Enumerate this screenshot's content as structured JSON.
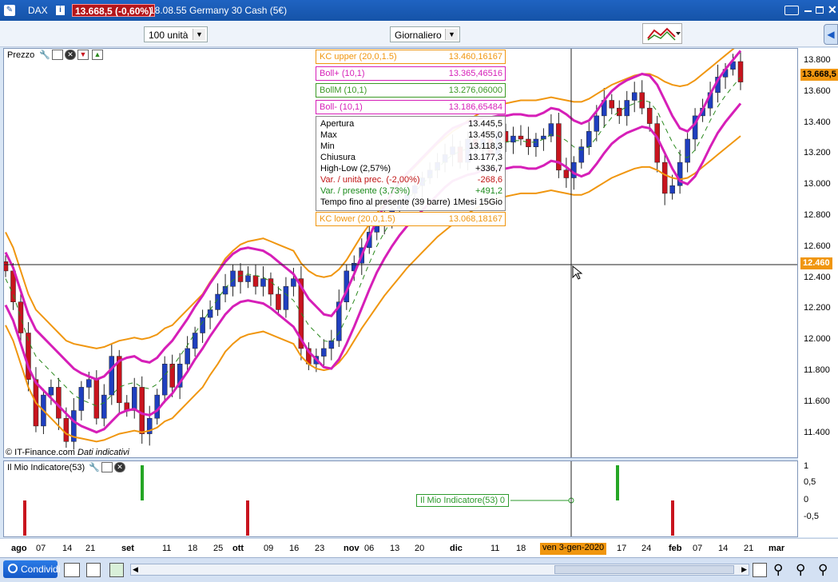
{
  "titlebar": {
    "symbol": "DAX",
    "price_badge": "13.668,5 (-0,60%)",
    "time_name": "18.08.55 Germany 30 Cash (5€)"
  },
  "toolbar": {
    "units": "100 unità",
    "period": "Giornaliero"
  },
  "chart_panel": {
    "label": "Prezzo",
    "copyright": "© IT-Finance.com",
    "note": "Dati indicativi"
  },
  "legends": [
    {
      "name": "KC upper (20,0,1.5)",
      "value": "13.460,16167",
      "color": "#f0960f"
    },
    {
      "name": "Boll+ (10,1)",
      "value": "13.365,46516",
      "color": "#d61fb8"
    },
    {
      "name": "BollM (10,1)",
      "value": "13.276,06000",
      "color": "#3c9a26"
    },
    {
      "name": "Boll- (10,1)",
      "value": "13.186,65484",
      "color": "#d61fb8"
    }
  ],
  "kc_lower": {
    "name": "KC lower (20,0,1.5)",
    "value": "13.068,18167",
    "color": "#f0960f"
  },
  "ohlc": [
    {
      "label": "Apertura",
      "value": "13.445,5",
      "color": "#000"
    },
    {
      "label": "Max",
      "value": "13.455,0",
      "color": "#000"
    },
    {
      "label": "Min",
      "value": "13.118,3",
      "color": "#000"
    },
    {
      "label": "Chiusura",
      "value": "13.177,3",
      "color": "#000"
    },
    {
      "label": "High-Low (2,57%)",
      "value": "+336,7",
      "color": "#000"
    },
    {
      "label": "Var. / unità prec. (-2,00%)",
      "value": "-268,6",
      "color": "#c01515"
    },
    {
      "label": "Var. / presente (3,73%)",
      "value": "+491,2",
      "color": "#1b8a1b"
    },
    {
      "label": "Tempo fino al presente (39 barre)",
      "value": "1Mesi 15Gio",
      "color": "#000"
    }
  ],
  "price_axis": {
    "ticks": [
      "13.800",
      "13.600",
      "13.400",
      "13.200",
      "13.000",
      "12.800",
      "12.600",
      "12.400",
      "12.200",
      "12.000",
      "11.800",
      "11.600",
      "11.400"
    ],
    "current": "13.668,5",
    "cursor": "12.460"
  },
  "indicator": {
    "label": "Il Mio Indicatore(53)",
    "tooltip_value": "0",
    "ticks": [
      "1",
      "0,5",
      "0",
      "-0,5"
    ]
  },
  "time_axis": {
    "ticks": [
      "ago",
      "07",
      "14",
      "21",
      "set",
      "11",
      "18",
      "25",
      "ott",
      "09",
      "16",
      "23",
      "nov",
      "06",
      "13",
      "20",
      "dic",
      "11",
      "18",
      "ven 3-gen-2020",
      "17",
      "24",
      "feb",
      "07",
      "14",
      "21",
      "mar"
    ]
  },
  "bottom": {
    "share_label": "Condividi"
  },
  "colors": {
    "up": "#1f3fbf",
    "down": "#c8141e",
    "kc": "#f0960f",
    "boll": "#d61fb8",
    "mid": "#2c8a1f",
    "accent": "#1a5bc4"
  },
  "chart_data": {
    "type": "candlestick",
    "ylim": [
      11300,
      13850
    ],
    "closes": [
      12450,
      12250,
      12050,
      11750,
      11450,
      11650,
      11700,
      11500,
      11350,
      11550,
      11700,
      11750,
      11500,
      11650,
      11900,
      11600,
      11550,
      11700,
      11400,
      11500,
      11650,
      11850,
      11700,
      11850,
      11950,
      12050,
      12150,
      12200,
      12300,
      12350,
      12450,
      12380,
      12420,
      12350,
      12400,
      12300,
      12200,
      12350,
      12400,
      11950,
      11850,
      11900,
      11950,
      12000,
      12250,
      12450,
      12500,
      12600,
      12700,
      12750,
      12800,
      12850,
      12900,
      12950,
      13000,
      13050,
      13100,
      13150,
      13200,
      13250,
      13150,
      13300,
      13250,
      13300,
      13200,
      13350,
      13280,
      13320,
      13300,
      13250,
      13300,
      13320,
      13400,
      13100,
      13050,
      13150,
      13250,
      13350,
      13450,
      13550,
      13500,
      13450,
      13550,
      13600,
      13500,
      13400,
      13150,
      12950,
      13000,
      13150,
      13300,
      13450,
      13500,
      13600,
      13700,
      13750,
      13800,
      13668
    ],
    "kc_mid": [
      12400,
      12300,
      12150,
      12000,
      11900,
      11850,
      11800,
      11750,
      11700,
      11680,
      11670,
      11660,
      11650,
      11660,
      11680,
      11700,
      11710,
      11720,
      11710,
      11720,
      11740,
      11780,
      11800,
      11850,
      11900,
      11950,
      12000,
      12080,
      12150,
      12230,
      12280,
      12320,
      12340,
      12350,
      12360,
      12340,
      12320,
      12300,
      12280,
      12200,
      12150,
      12120,
      12110,
      12120,
      12160,
      12220,
      12300,
      12380,
      12450,
      12520,
      12590,
      12650,
      12710,
      12770,
      12820,
      12870,
      12920,
      12970,
      13010,
      13050,
      13080,
      13120,
      13150,
      13180,
      13200,
      13220,
      13230,
      13240,
      13250,
      13250,
      13250,
      13260,
      13270,
      13260,
      13250,
      13240,
      13240,
      13260,
      13290,
      13320,
      13350,
      13370,
      13390,
      13410,
      13420,
      13420,
      13400,
      13370,
      13350,
      13340,
      13350,
      13380,
      13420,
      13460,
      13500,
      13540,
      13580,
      13620
    ],
    "boll_mid": [
      12400,
      12300,
      12150,
      12000,
      11900,
      11850,
      11800,
      11750,
      11700,
      11650,
      11620,
      11600,
      11580,
      11600,
      11650,
      11700,
      11720,
      11730,
      11700,
      11690,
      11720,
      11780,
      11830,
      11900,
      11970,
      12050,
      12120,
      12200,
      12270,
      12340,
      12390,
      12420,
      12430,
      12420,
      12410,
      12380,
      12340,
      12300,
      12260,
      12180,
      12100,
      12050,
      12000,
      11990,
      12050,
      12150,
      12260,
      12380,
      12500,
      12610,
      12700,
      12780,
      12850,
      12910,
      12960,
      13010,
      13060,
      13110,
      13160,
      13200,
      13220,
      13240,
      13250,
      13270,
      13270,
      13280,
      13280,
      13290,
      13290,
      13280,
      13280,
      13300,
      13330,
      13320,
      13290,
      13250,
      13230,
      13250,
      13310,
      13380,
      13440,
      13480,
      13510,
      13530,
      13550,
      13540,
      13480,
      13380,
      13280,
      13200,
      13180,
      13230,
      13320,
      13420,
      13510,
      13580,
      13640,
      13700
    ],
    "indicator_signals": [
      {
        "bar": 3,
        "value": -1
      },
      {
        "bar": 26,
        "value": 1
      },
      {
        "bar": 46,
        "value": -1
      },
      {
        "bar": 116,
        "value": 1
      },
      {
        "bar": 131,
        "value": -1
      }
    ]
  }
}
